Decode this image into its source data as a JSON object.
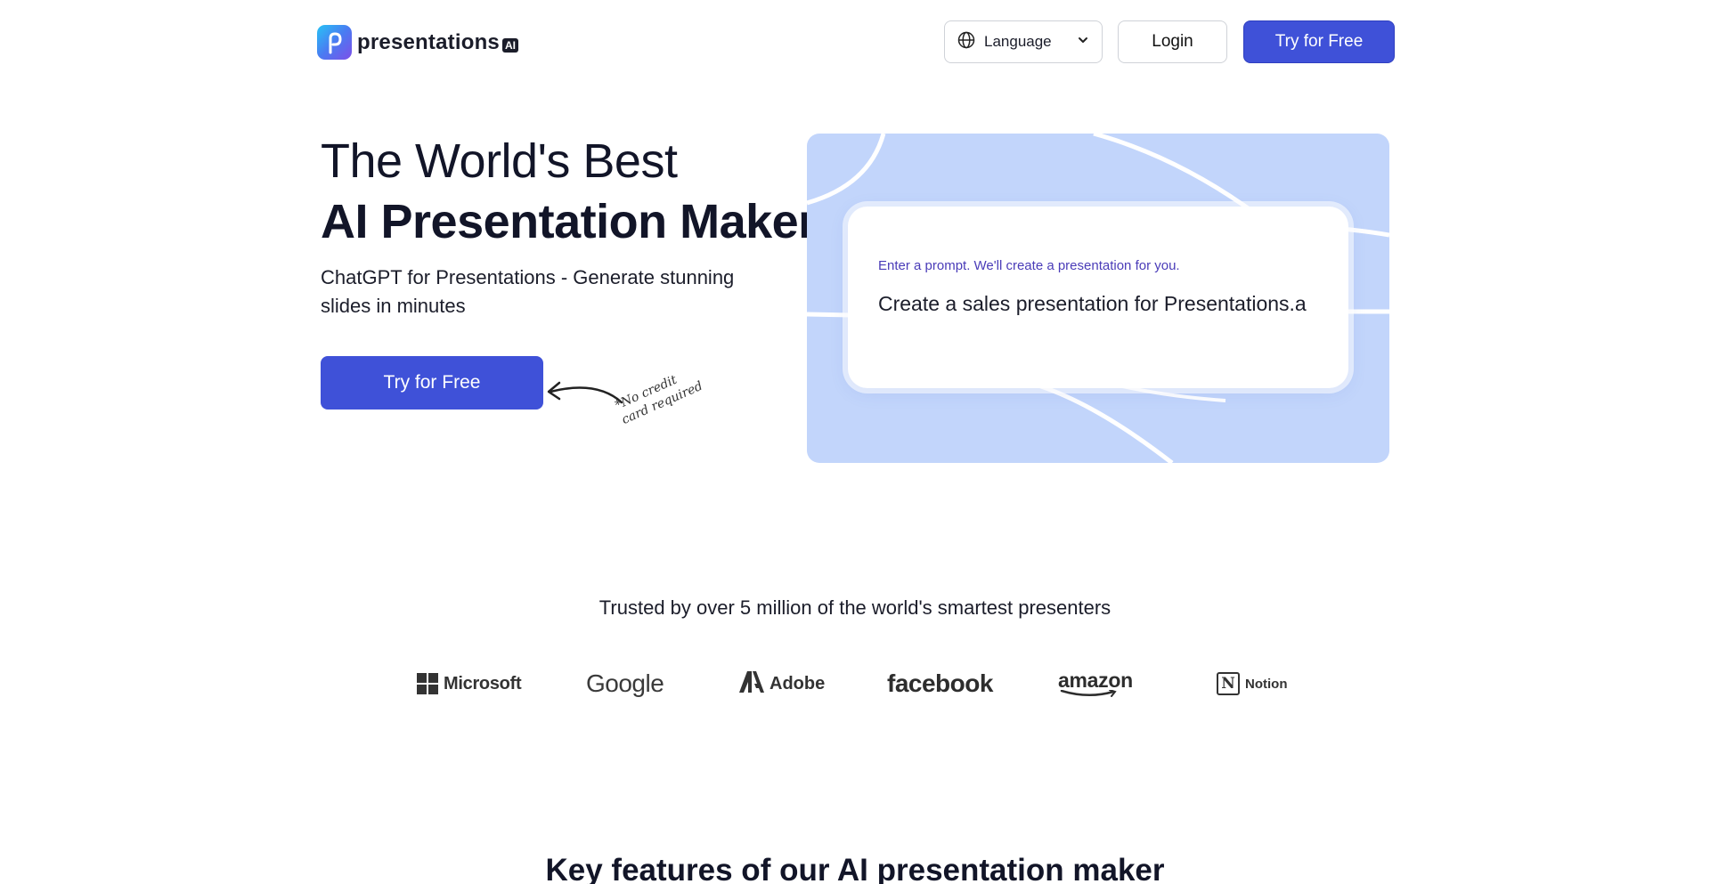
{
  "header": {
    "logo_text": "presentations",
    "logo_badge": "AI",
    "language_label": "Language",
    "login_label": "Login",
    "try_label": "Try for Free"
  },
  "hero": {
    "title_line1": "The World's Best",
    "title_line2": "AI Presentation Maker",
    "subtitle": "ChatGPT for Presentations - Generate stunning slides in minutes",
    "cta_label": "Try for Free",
    "note_line1": "*No credit",
    "note_line2": "card required",
    "prompt_hint": "Enter a prompt. We'll create a presentation for you.",
    "prompt_text": "Create a sales presentation for Presentations.a"
  },
  "trusted": {
    "text": "Trusted by over 5 million of the world's smartest presenters",
    "logos": [
      "Microsoft",
      "Google",
      "Adobe",
      "facebook",
      "amazon",
      "Notion"
    ]
  },
  "features": {
    "heading_regular": "Key features of our ",
    "heading_bold": "AI presentation maker"
  },
  "colors": {
    "primary": "#3f51d8",
    "hero_visual_bg": "#c2d5fb",
    "prompt_hint": "#4a3cb8",
    "text_dark": "#121528"
  }
}
